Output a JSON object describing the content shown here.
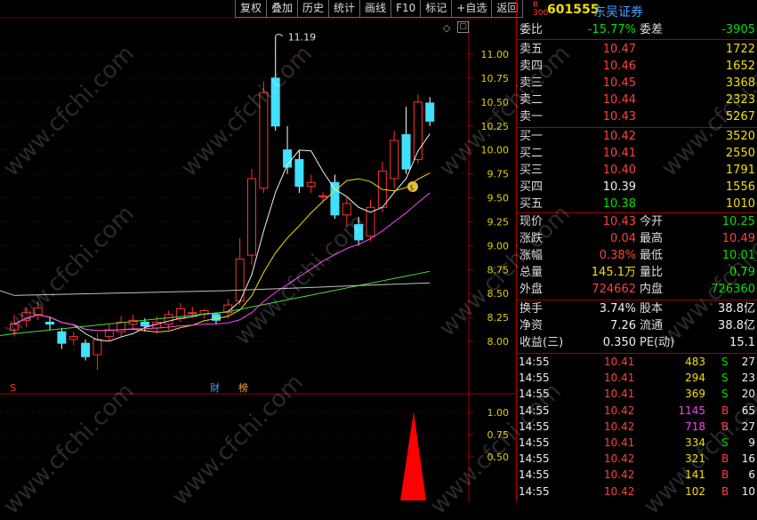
{
  "toolbar": {
    "items": [
      "复权",
      "叠加",
      "历史",
      "统计",
      "画线",
      "F10",
      "标记",
      "+自选",
      "返回"
    ]
  },
  "chart_data": {
    "type": "candlestick",
    "price_axis": {
      "ticks": [
        "11.00",
        "10.75",
        "10.50",
        "10.25",
        "10.00",
        "9.75",
        "9.50",
        "9.25",
        "9.00",
        "8.75",
        "8.50",
        "8.25",
        "8.00"
      ]
    },
    "volume_axis": {
      "ticks": [
        "1.00",
        "0.75",
        "0.50"
      ]
    },
    "high_label": "11.19",
    "candles": [
      {
        "o": 8.12,
        "c": 8.18,
        "h": 8.28,
        "l": 8.05,
        "up": true
      },
      {
        "o": 8.22,
        "c": 8.3,
        "h": 8.36,
        "l": 8.15,
        "up": true
      },
      {
        "o": 8.28,
        "c": 8.35,
        "h": 8.42,
        "l": 8.22,
        "up": true
      },
      {
        "o": 8.2,
        "c": 8.18,
        "h": 8.26,
        "l": 8.12,
        "up": false
      },
      {
        "o": 8.1,
        "c": 7.98,
        "h": 8.14,
        "l": 7.92,
        "up": false
      },
      {
        "o": 8.02,
        "c": 8.05,
        "h": 8.1,
        "l": 7.96,
        "up": true
      },
      {
        "o": 7.98,
        "c": 7.84,
        "h": 8.02,
        "l": 7.8,
        "up": false
      },
      {
        "o": 7.86,
        "c": 8.02,
        "h": 8.08,
        "l": 7.7,
        "up": true
      },
      {
        "o": 8.05,
        "c": 8.12,
        "h": 8.18,
        "l": 8.0,
        "up": true
      },
      {
        "o": 8.1,
        "c": 8.2,
        "h": 8.26,
        "l": 8.05,
        "up": true
      },
      {
        "o": 8.18,
        "c": 8.22,
        "h": 8.28,
        "l": 8.12,
        "up": true
      },
      {
        "o": 8.2,
        "c": 8.16,
        "h": 8.24,
        "l": 8.1,
        "up": false
      },
      {
        "o": 8.14,
        "c": 8.2,
        "h": 8.26,
        "l": 8.08,
        "up": true
      },
      {
        "o": 8.18,
        "c": 8.28,
        "h": 8.32,
        "l": 8.12,
        "up": true
      },
      {
        "o": 8.24,
        "c": 8.34,
        "h": 8.4,
        "l": 8.2,
        "up": true
      },
      {
        "o": 8.3,
        "c": 8.3,
        "h": 8.36,
        "l": 8.26,
        "up": true
      },
      {
        "o": 8.28,
        "c": 8.32,
        "h": 8.34,
        "l": 8.24,
        "up": true
      },
      {
        "o": 8.28,
        "c": 8.22,
        "h": 8.3,
        "l": 8.18,
        "up": false
      },
      {
        "o": 8.3,
        "c": 8.38,
        "h": 8.44,
        "l": 8.24,
        "up": true
      },
      {
        "o": 8.42,
        "c": 8.86,
        "h": 9.08,
        "l": 8.38,
        "up": true
      },
      {
        "o": 8.9,
        "c": 9.7,
        "h": 9.8,
        "l": 8.8,
        "up": true
      },
      {
        "o": 9.6,
        "c": 10.6,
        "h": 10.72,
        "l": 9.55,
        "up": true
      },
      {
        "o": 10.75,
        "c": 10.25,
        "h": 11.19,
        "l": 10.2,
        "up": false
      },
      {
        "o": 10.0,
        "c": 9.82,
        "h": 10.25,
        "l": 9.75,
        "up": false
      },
      {
        "o": 9.9,
        "c": 9.62,
        "h": 10.0,
        "l": 9.55,
        "up": false
      },
      {
        "o": 9.62,
        "c": 9.66,
        "h": 9.74,
        "l": 9.55,
        "up": true
      },
      {
        "o": 9.52,
        "c": 9.52,
        "h": 9.56,
        "l": 9.46,
        "up": true
      },
      {
        "o": 9.66,
        "c": 9.32,
        "h": 9.74,
        "l": 9.28,
        "up": false
      },
      {
        "o": 9.32,
        "c": 9.44,
        "h": 9.5,
        "l": 9.2,
        "up": true
      },
      {
        "o": 9.22,
        "c": 9.06,
        "h": 9.3,
        "l": 9.0,
        "up": false
      },
      {
        "o": 9.1,
        "c": 9.4,
        "h": 9.48,
        "l": 9.05,
        "up": true
      },
      {
        "o": 9.4,
        "c": 9.78,
        "h": 9.88,
        "l": 9.35,
        "up": true
      },
      {
        "o": 9.7,
        "c": 10.1,
        "h": 10.2,
        "l": 9.6,
        "up": true
      },
      {
        "o": 9.8,
        "c": 10.16,
        "h": 10.45,
        "l": 9.75,
        "up": false
      },
      {
        "o": 9.9,
        "c": 10.5,
        "h": 10.58,
        "l": 9.86,
        "up": true
      },
      {
        "o": 10.49,
        "c": 10.3,
        "h": 10.55,
        "l": 10.25,
        "up": false
      }
    ],
    "ma_lines": [
      {
        "name": "MA5",
        "color": "#f0f0f0"
      },
      {
        "name": "MA10",
        "color": "#f0e000"
      },
      {
        "name": "MA20",
        "color": "#ff40ff"
      },
      {
        "name": "MA60",
        "color": "#40e040"
      },
      {
        "name": "MA120",
        "color": "#c0c0c0"
      }
    ],
    "markers": {
      "s_label": "S",
      "cai": "财",
      "bang": "榜"
    }
  },
  "quote": {
    "r_tag": "R",
    "r_num": "300",
    "code": "601555",
    "name": "东吴证券",
    "weibi_label": "委比",
    "weibi_value": "-15.77%",
    "weicha_label": "委差",
    "weicha_value": "-3905",
    "asks": [
      {
        "label": "卖五",
        "price": "10.47",
        "vol": "1722"
      },
      {
        "label": "卖四",
        "price": "10.46",
        "vol": "1652"
      },
      {
        "label": "卖三",
        "price": "10.45",
        "vol": "3368"
      },
      {
        "label": "卖二",
        "price": "10.44",
        "vol": "2323"
      },
      {
        "label": "卖一",
        "price": "10.43",
        "vol": "5267"
      }
    ],
    "bids": [
      {
        "label": "买一",
        "price": "10.42",
        "vol": "3520"
      },
      {
        "label": "买二",
        "price": "10.41",
        "vol": "2550"
      },
      {
        "label": "买三",
        "price": "10.40",
        "vol": "1791"
      },
      {
        "label": "买四",
        "price": "10.39",
        "vol": "1556"
      },
      {
        "label": "买五",
        "price": "10.38",
        "vol": "1010"
      }
    ],
    "stats": [
      {
        "l1": "现价",
        "v1": "10.43",
        "c1": "red",
        "l2": "今开",
        "v2": "10.25",
        "c2": "green"
      },
      {
        "l1": "涨跌",
        "v1": "0.04",
        "c1": "red",
        "l2": "最高",
        "v2": "10.49",
        "c2": "red"
      },
      {
        "l1": "涨幅",
        "v1": "0.38%",
        "c1": "red",
        "l2": "最低",
        "v2": "10.01",
        "c2": "green"
      },
      {
        "l1": "总量",
        "v1": "145.1万",
        "c1": "yellow",
        "l2": "量比",
        "v2": "0.79",
        "c2": "green"
      },
      {
        "l1": "外盘",
        "v1": "724662",
        "c1": "red",
        "l2": "内盘",
        "v2": "726360",
        "c2": "green"
      }
    ],
    "fin": [
      {
        "l1": "换手",
        "v1": "3.74%",
        "l2": "股本",
        "v2": "38.8亿"
      },
      {
        "l1": "净资",
        "v1": "7.26",
        "l2": "流通",
        "v2": "38.8亿"
      },
      {
        "l1": "收益(三)",
        "v1": "0.350",
        "l2": "PE(动)",
        "v2": "15.1"
      }
    ]
  },
  "ticks": [
    {
      "time": "14:55",
      "price": "10.41",
      "vol": "483",
      "bs": "S",
      "n": "27"
    },
    {
      "time": "14:55",
      "price": "10.41",
      "vol": "294",
      "bs": "S",
      "n": "23"
    },
    {
      "time": "14:55",
      "price": "10.41",
      "vol": "369",
      "bs": "S",
      "n": "20"
    },
    {
      "time": "14:55",
      "price": "10.42",
      "vol": "1145",
      "bs": "B",
      "n": "65"
    },
    {
      "time": "14:55",
      "price": "10.42",
      "vol": "718",
      "bs": "B",
      "n": "27"
    },
    {
      "time": "14:55",
      "price": "10.41",
      "vol": "334",
      "bs": "S",
      "n": "9"
    },
    {
      "time": "14:55",
      "price": "10.42",
      "vol": "321",
      "bs": "B",
      "n": "16"
    },
    {
      "time": "14:55",
      "price": "10.42",
      "vol": "141",
      "bs": "B",
      "n": "6"
    },
    {
      "time": "14:55",
      "price": "10.42",
      "vol": "102",
      "bs": "B",
      "n": "10"
    }
  ],
  "watermark": "www.cfchi.com",
  "colors": {
    "up": "#ff3030",
    "down": "#40e0ff",
    "grid": "#a00000",
    "axis": "#e0d000"
  }
}
